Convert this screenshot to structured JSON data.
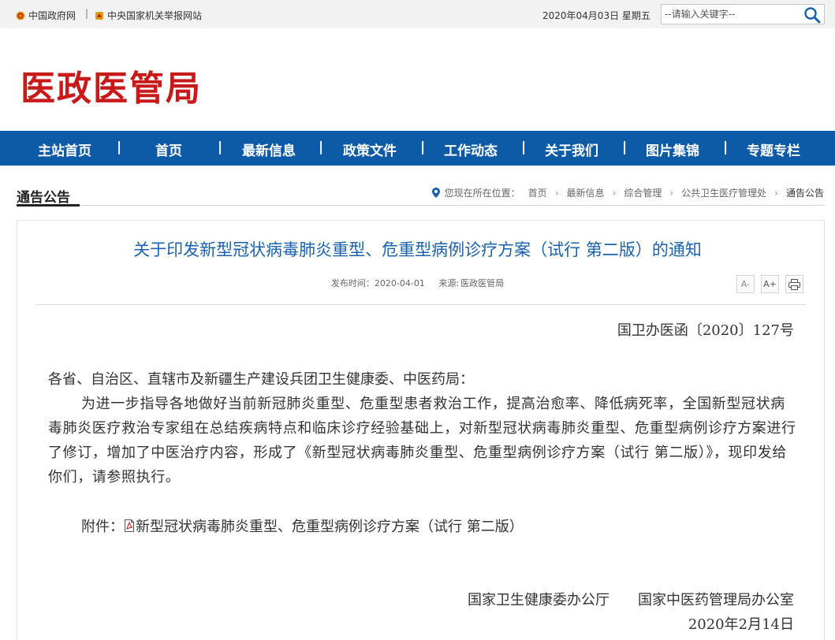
{
  "topbar": {
    "link1": "中国政府网",
    "separator": "|",
    "link2": "中央国家机关举报网站",
    "date": "2020年04月03日 星期五",
    "search_placeholder": "--请输入关键字--"
  },
  "header": {
    "site_title": "医政医管局"
  },
  "nav": {
    "items": [
      "主站首页",
      "首页",
      "最新信息",
      "政策文件",
      "工作动态",
      "关于我们",
      "图片集锦",
      "专题专栏"
    ],
    "separator": "|"
  },
  "location": {
    "section_title": "通告公告",
    "label": "您现在所在位置：",
    "crumbs": [
      "首页",
      "最新信息",
      "综合管理",
      "公共卫生医疗管理处",
      "通告公告"
    ],
    "crumb_sep": "›"
  },
  "article": {
    "title": "关于印发新型冠状病毒肺炎重型、危重型病例诊疗方案（试行 第二版）的通知",
    "publish_label": "发布时间：",
    "publish_date": "2020-04-01",
    "source_label": "来源:",
    "source": "医政医管局",
    "tools": [
      "A-",
      "A+",
      "print"
    ],
    "doc_number": "国卫办医函〔2020〕127号",
    "salutation": "各省、自治区、直辖市及新疆生产建设兵团卫生健康委、中医药局：",
    "paragraph": "为进一步指导各地做好当前新冠肺炎重型、危重型患者救治工作，提高治愈率、降低病死率，全国新型冠状病毒肺炎医疗救治专家组在总结疾病特点和临床诊疗经验基础上，对新型冠状病毒肺炎重型、危重型病例诊疗方案进行了修订，增加了中医治疗内容，形成了《新型冠状病毒肺炎重型、危重型病例诊疗方案（试行 第二版）》，现印发给你们，请参照执行。",
    "attachment_label": "附件：",
    "attachment_title": "新型冠状病毒肺炎重型、危重型病例诊疗方案（试行 第二版）",
    "signatory1": "国家卫生健康委办公厅",
    "signatory2": "国家中医药管理局办公室",
    "sign_date": "2020年2月14日"
  },
  "colors": {
    "brand_red": "#c81a1a",
    "nav_blue": "#0d5aa7",
    "title_blue": "#1a62ad"
  }
}
